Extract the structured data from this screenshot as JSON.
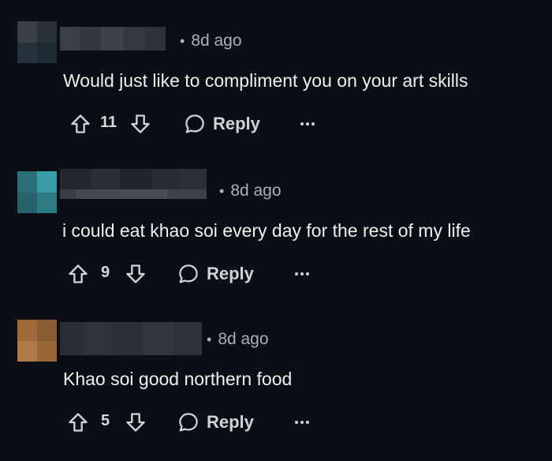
{
  "comments": [
    {
      "time": "8d ago",
      "text": "Would just like to compliment you on your art skills",
      "votes": "11",
      "reply_label": "Reply",
      "more_icon": "ellipsis-icon",
      "avatar_colors": [
        "#3a3f47",
        "#2a3038",
        "#26323b",
        "#1f2a33"
      ]
    },
    {
      "time": "8d ago",
      "text": "i could eat khao soi every day for the rest of my life",
      "votes": "9",
      "reply_label": "Reply",
      "more_icon": "ellipsis-icon",
      "avatar_colors": [
        "#2c6f78",
        "#3b9ea6",
        "#27626b",
        "#2e7b84"
      ]
    },
    {
      "time": "8d ago",
      "text": "Khao soi good northern food",
      "votes": "5",
      "reply_label": "Reply",
      "more_icon": "ellipsis-icon",
      "avatar_colors": [
        "#a06a3c",
        "#8a5a33",
        "#b07a48",
        "#9a6838"
      ]
    }
  ],
  "colors": {
    "background": "#0b0e14",
    "text": "#eef0f2",
    "muted": "#a9b0b6"
  }
}
